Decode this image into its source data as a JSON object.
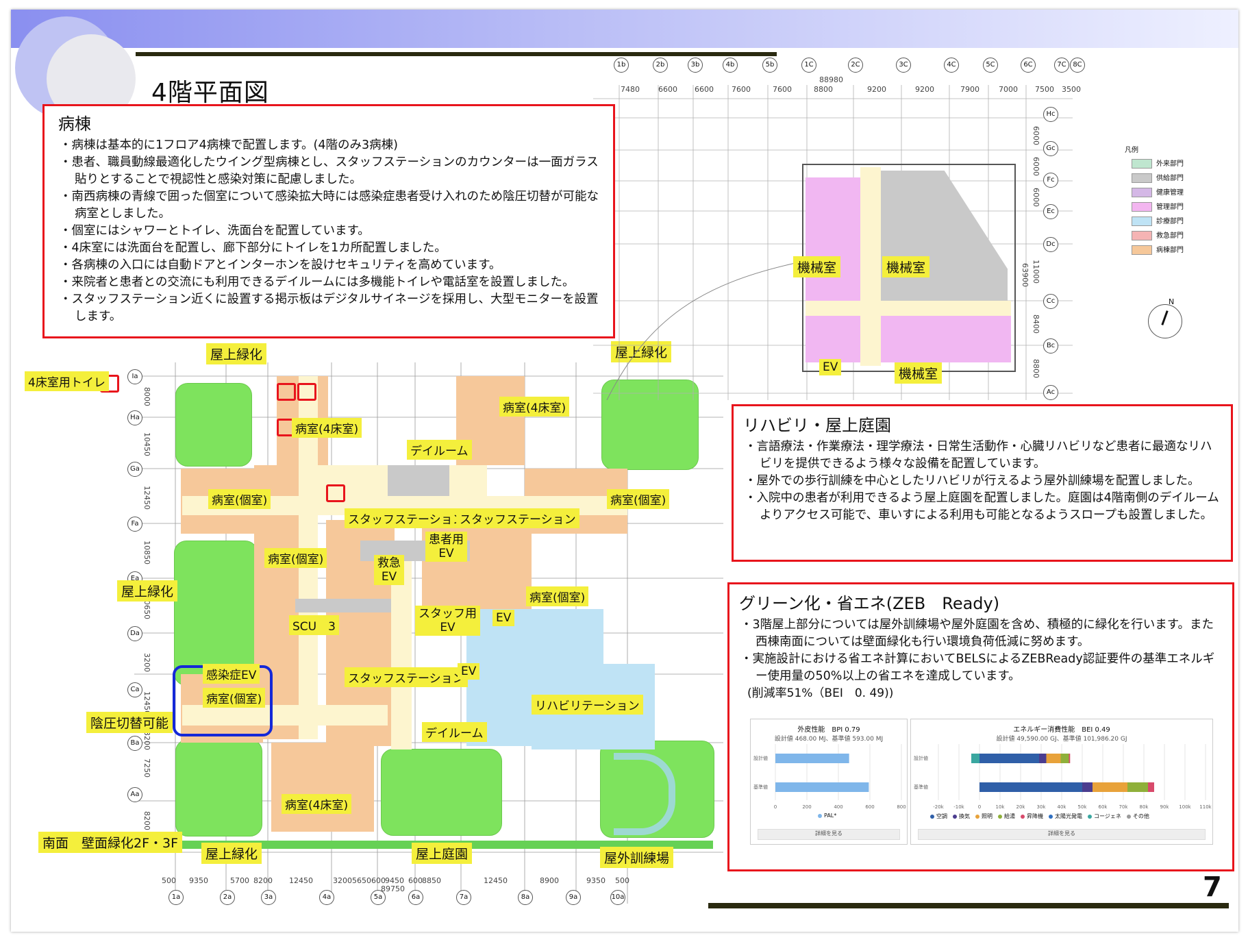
{
  "page": {
    "title": "4階平面図",
    "page_number": "7"
  },
  "ward_box": {
    "heading": "病棟",
    "items": [
      "病棟は基本的に1フロア4病棟で配置します。(4階のみ3病棟)",
      "患者、職員動線最適化したウイング型病棟とし、スタッフステーションのカウンターは一面ガラス貼りとすることで視認性と感染対策に配慮しました。",
      "南西病棟の青線で囲った個室について感染拡大時には感染症患者受け入れのため陰圧切替が可能な病室としました。",
      "個室にはシャワーとトイレ、洗面台を配置しています。",
      "4床室には洗面台を配置し、廊下部分にトイレを1カ所配置しました。",
      "各病棟の入口には自動ドアとインターホンを設けセキュリティを高めています。",
      "来院者と患者との交流にも利用できるデイルームには多機能トイレや電話室を設置しました。",
      "スタッフステーション近くに設置する掲示板はデジタルサイネージを採用し、大型モニターを設置します。"
    ]
  },
  "rehab_box": {
    "heading": "リハビリ・屋上庭園",
    "items": [
      "言語療法・作業療法・理学療法・日常生活動作・心臓リハビリなど患者に最適なリハビリを提供できるよう様々な設備を配置しています。",
      "屋外での歩行訓練を中心としたリハビリが行えるよう屋外訓練場を配置しました。",
      "入院中の患者が利用できるよう屋上庭園を配置しました。庭園は4階南側のデイルームよりアクセス可能で、車いすによる利用も可能となるようスロープも設置しました。"
    ]
  },
  "green_box": {
    "heading": "グリーン化・省エネ(ZEB　Ready)",
    "items": [
      "3階屋上部分については屋外訓練場や屋外庭園を含め、積極的に緑化を行います。また西棟南面については壁面緑化も行い環境負荷低減に努めます。",
      "実施設計における省エネ計算においてBELSによるZEBReady認証要件の基準エネルギー使用量の50%以上の省エネを達成しています。"
    ],
    "note": "(削減率51%（BEI　0. 49))"
  },
  "plan_labels": {
    "rooftop_green_nw": "屋上緑化",
    "rooftop_green_ne": "屋上緑化",
    "rooftop_green_w": "屋上緑化",
    "rooftop_green_sw": "屋上緑化",
    "toilet_4bed": "4床室用トイレ",
    "ward_4bed_n": "病室(4床室)",
    "ward_4bed_ne": "病室(4床室)",
    "ward_4bed_s": "病室(4床室)",
    "dayroom_n": "デイルーム",
    "dayroom_s": "デイルーム",
    "private_w": "病室(個室)",
    "private_e": "病室(個室)",
    "private_c": "病室(個室)",
    "private_se": "病室(個室)",
    "staff_station_1": "スタッフステーション",
    "staff_station_2": "スタッフステーション",
    "staff_station_3": "スタッフステーション",
    "patient_ev": "患者用\nEV",
    "emergency_ev": "救急\nEV",
    "staff_ev": "スタッフ用\nEV",
    "ev_1": "EV",
    "ev_2": "EV",
    "scu": "SCU　3",
    "infection_ev": "感染症EV",
    "private_infection": "病室(個室)",
    "negative_pressure": "陰圧切替可能",
    "rehabilitation": "リハビリテーション",
    "south_wall_green": "南面　壁面緑化2F・3F",
    "rooftop_garden": "屋上庭園",
    "outdoor_training": "屋外訓練場",
    "machine_1": "機械室",
    "machine_2": "機械室",
    "machine_3": "機械室",
    "ev_annex": "EV"
  },
  "grid": {
    "top_axes": [
      "1b",
      "2b",
      "3b",
      "4b",
      "5b",
      "1C",
      "2C",
      "3C",
      "4C",
      "5C",
      "6C",
      "7C",
      "8C"
    ],
    "top_dims": [
      "7480",
      "6600",
      "6600",
      "7600",
      "7600",
      "8800",
      "9200",
      "9200",
      "7900",
      "7000",
      "7500",
      "3500"
    ],
    "top_total": "88980",
    "right_axes": [
      "Hc",
      "Gc",
      "Fc",
      "Ec",
      "Dc",
      "Cc",
      "Bc",
      "Ac"
    ],
    "right_dims": [
      "6000",
      "6000",
      "6000",
      "11000",
      "8400",
      "8800"
    ],
    "right_total": "63900",
    "left_axes": [
      "Ia",
      "Ha",
      "Ga",
      "Fa",
      "Ea",
      "Da",
      "Ca",
      "Ba",
      "Aa"
    ],
    "left_dims": [
      "8000",
      "10450",
      "12450",
      "10850",
      "10650",
      "3200",
      "12450",
      "3200",
      "7250",
      "8200"
    ],
    "bottom_axes": [
      "1a",
      "2a",
      "3a",
      "4a",
      "5a",
      "6a",
      "7a",
      "8a",
      "9a",
      "10a"
    ],
    "bottom_dims": [
      "500",
      "9350",
      "5700",
      "8200",
      "12450",
      "3200",
      "5650",
      "600",
      "9450",
      "600",
      "8850",
      "12450",
      "8900",
      "9350",
      "500"
    ],
    "bottom_total": "89750"
  },
  "legend": {
    "title": "凡例",
    "items": [
      {
        "label": "外来部門",
        "color": "#bfe6cf"
      },
      {
        "label": "供給部門",
        "color": "#c9c9c9"
      },
      {
        "label": "健康管理",
        "color": "#d4b8e6"
      },
      {
        "label": "管理部門",
        "color": "#f3b6f0"
      },
      {
        "label": "診療部門",
        "color": "#bfe3f5"
      },
      {
        "label": "救急部門",
        "color": "#f5b4b4"
      },
      {
        "label": "病棟部門",
        "color": "#f6c89a"
      }
    ],
    "north": "N"
  },
  "chart_data": [
    {
      "type": "bar",
      "title": "外皮性能",
      "subtitle_metric": "BPI 0.79",
      "subtitle": "設計値 468.00 MJ、基準値 593.00 MJ",
      "categories": [
        "設計値",
        "基準値"
      ],
      "series": [
        {
          "name": "PAL*",
          "values": [
            468,
            593
          ],
          "color": "#7fb6ea"
        }
      ],
      "xlim": [
        0,
        800
      ],
      "xticks": [
        "0",
        "200",
        "400",
        "600",
        "800"
      ],
      "button": "詳細を見る"
    },
    {
      "type": "bar",
      "title": "エネルギー消費性能",
      "subtitle_metric": "BEI 0.49",
      "subtitle": "設計値 49,590.00 GJ、基準値 101,986.20 GJ",
      "categories": [
        "設計値",
        "基準値"
      ],
      "xlim": [
        -20000,
        110000
      ],
      "xticks": [
        "-20k",
        "-10k",
        "0",
        "10k",
        "20k",
        "30k",
        "40k",
        "50k",
        "60k",
        "70k",
        "80k",
        "90k",
        "100k",
        "110k"
      ],
      "series": [
        {
          "name": "空調",
          "color": "#2f5fa8",
          "values": [
            29000,
            50000
          ]
        },
        {
          "name": "換気",
          "color": "#4b3d8f",
          "values": [
            3500,
            5000
          ]
        },
        {
          "name": "照明",
          "color": "#e8a23a",
          "values": [
            7000,
            17000
          ]
        },
        {
          "name": "給湯",
          "color": "#8fb03a",
          "values": [
            4000,
            10000
          ]
        },
        {
          "name": "昇降機",
          "color": "#d84a6b",
          "values": [
            600,
            3000
          ]
        },
        {
          "name": "太陽光発電",
          "color": "#2f6fc0",
          "values": [
            0,
            0
          ]
        },
        {
          "name": "コージェネ",
          "color": "#3aa7a0",
          "values": [
            -4000,
            0
          ]
        },
        {
          "name": "その他",
          "color": "#9a9a9a",
          "values": [
            0,
            0
          ]
        }
      ],
      "button": "詳細を見る"
    }
  ]
}
